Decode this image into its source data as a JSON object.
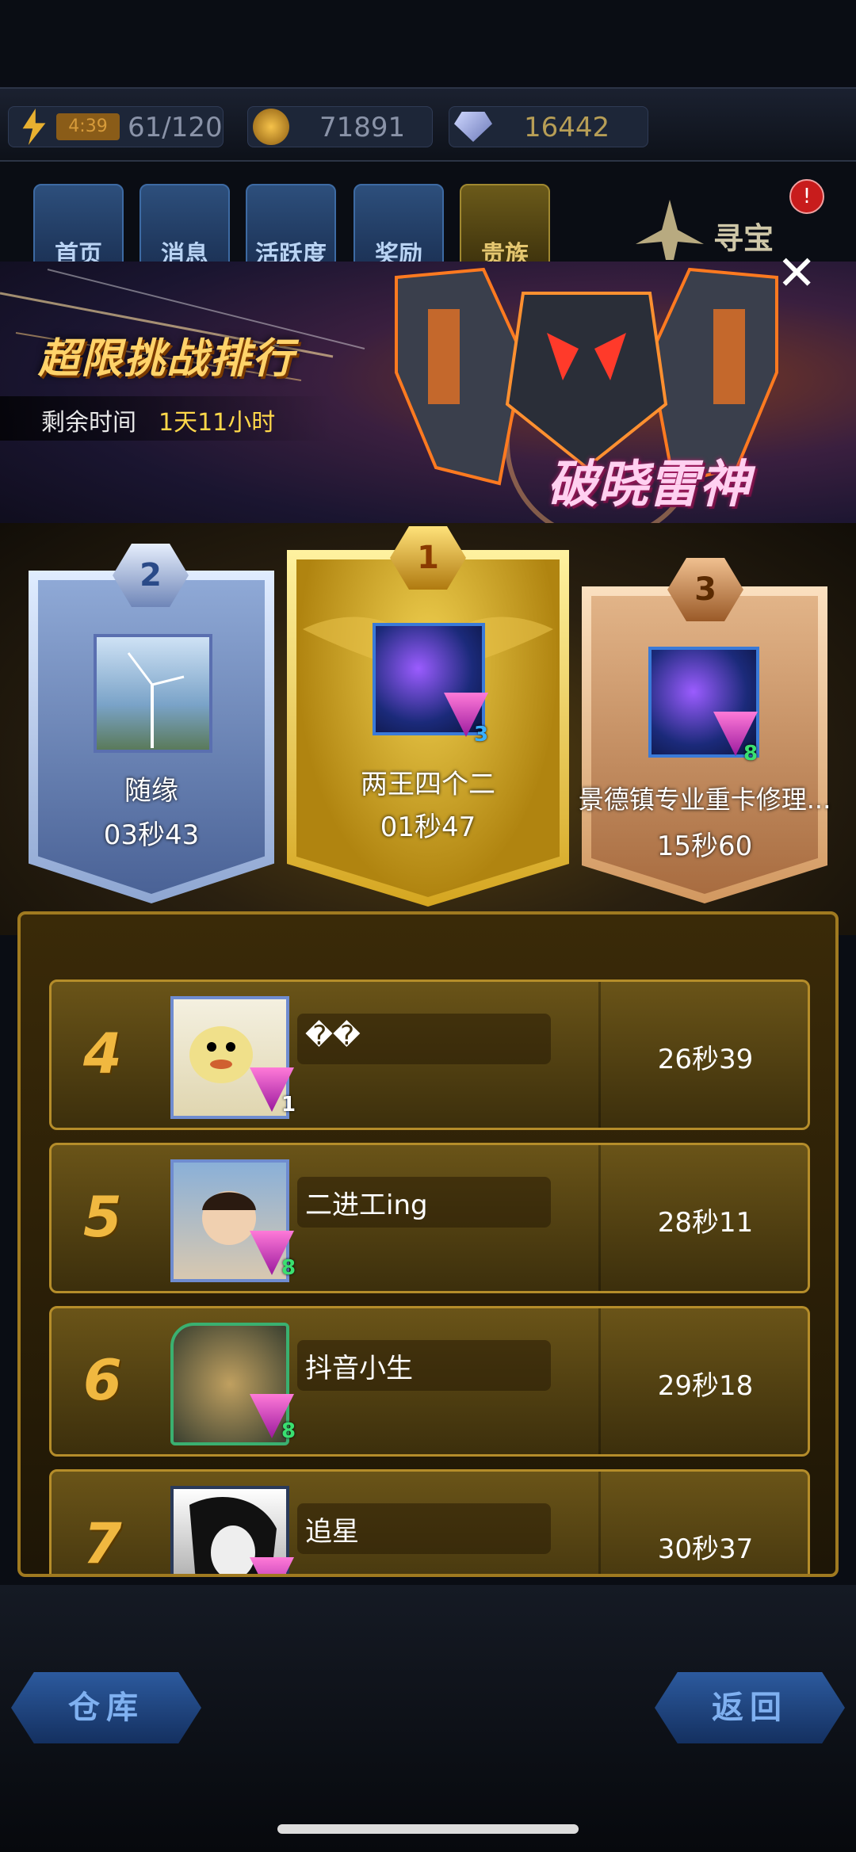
{
  "resources": {
    "energy_timer": "4:39",
    "energy": "61/120",
    "coins": "71891",
    "gems": "16442"
  },
  "tabs": [
    {
      "label": "首页",
      "icon": "home-icon"
    },
    {
      "label": "消息",
      "icon": "mail-icon"
    },
    {
      "label": "活跃度",
      "icon": "smile-icon"
    },
    {
      "label": "奖励",
      "icon": "gift-icon"
    },
    {
      "label": "贵族",
      "icon": "vip-icon"
    }
  ],
  "treasure": {
    "label": "寻宝",
    "badge": "!"
  },
  "event": {
    "title": "超限挑战排行",
    "remaining_label": "剩余时间",
    "remaining_value": "1天11小时",
    "ship_name": "破晓雷神",
    "close": "✕"
  },
  "podium": [
    {
      "rank": "2",
      "name": "随缘",
      "time": "03秒43"
    },
    {
      "rank": "1",
      "name": "两王四个二",
      "time": "01秒47",
      "vip": "3"
    },
    {
      "rank": "3",
      "name": "景德镇专业重卡修理...",
      "time": "15秒60",
      "vip": "8"
    }
  ],
  "ranking": [
    {
      "rank": "4",
      "name": "��",
      "time": "26秒39",
      "vip": "1"
    },
    {
      "rank": "5",
      "name": "二进工ing",
      "time": "28秒11",
      "vip": "8"
    },
    {
      "rank": "6",
      "name": "抖音小生",
      "time": "29秒18",
      "vip": "8"
    },
    {
      "rank": "7",
      "name": "追星",
      "time": "30秒37"
    }
  ],
  "bottom": {
    "warehouse": "仓库",
    "back": "返回"
  },
  "colors": {
    "gold": "#ffd36a",
    "accent_yellow": "#ffd84a",
    "silver": "#9fb4d8",
    "bronze": "#c98a58"
  }
}
